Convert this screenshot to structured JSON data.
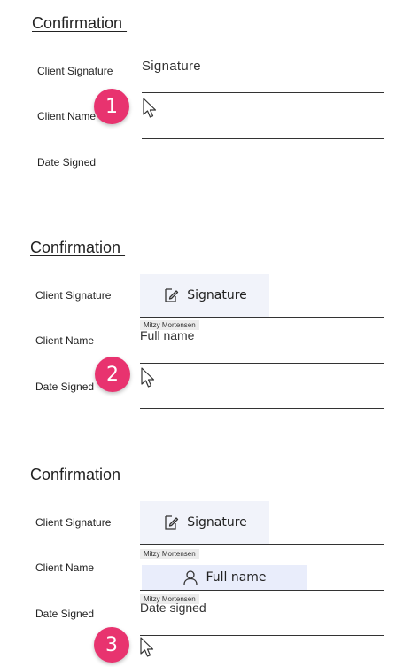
{
  "panels": [
    {
      "heading": "Confirmation ",
      "labels": {
        "signature": "Client Signature",
        "name": "Client Name",
        "date": "Date Signed"
      },
      "signature_text": "Signature",
      "step": "1"
    },
    {
      "heading": "Confirmation ",
      "labels": {
        "signature": "Client Signature",
        "name": "Client Name",
        "date": "Date Signed"
      },
      "signature_button": "Signature",
      "signer_tag": "Mitzy Mortensen",
      "name_placeholder": "Full name",
      "step": "2"
    },
    {
      "heading": "Confirmation ",
      "labels": {
        "signature": "Client Signature",
        "name": "Client Name",
        "date": "Date Signed"
      },
      "signature_button": "Signature",
      "signer_tag_1": "Mitzy Mortensen",
      "name_button": "Full name",
      "signer_tag_2": "Mitzy Mortensen",
      "date_placeholder": "Date signed",
      "step": "3"
    }
  ],
  "colors": {
    "badge": "#e8336f",
    "button_bg": "#f1f3fa",
    "button_active_bg": "#e9edfb"
  }
}
